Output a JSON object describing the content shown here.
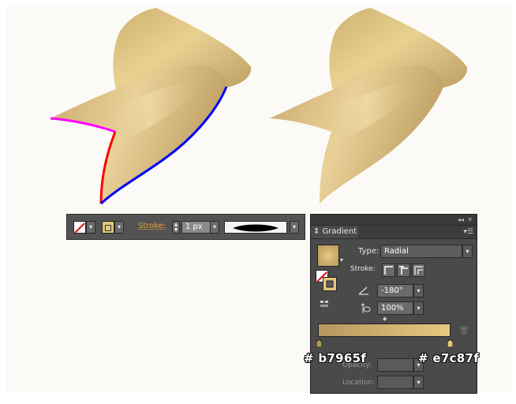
{
  "toolbar": {
    "stroke_label": "Stroke:",
    "stroke_weight": "1 px"
  },
  "gradient_panel": {
    "tab_title": "Gradient",
    "type_label": "Type:",
    "type_value": "Radial",
    "stroke_label": "Stroke:",
    "angle_value": "-180°",
    "aspect_value": "100%",
    "opacity_label": "Opacity:",
    "location_label": "Location:",
    "stops": [
      {
        "color": "#b7965f",
        "location": 0
      },
      {
        "color": "#e7c87f",
        "location": 100
      }
    ]
  },
  "annotations": {
    "left_stop_hex": "# b7965f",
    "right_stop_hex": "# e7c87f"
  },
  "colors": {
    "guide_magenta": "#ff00ff",
    "guide_red": "#ff0000",
    "guide_blue": "#0000ff",
    "panel_bg": "#4a4a4a",
    "stroke_label_color": "#f0a030"
  },
  "icons": [
    "none-swatch-icon",
    "stroke-swatch-icon",
    "angle-icon",
    "aspect-ratio-icon",
    "gradient-annotator-icon",
    "trash-icon",
    "panel-menu-icon"
  ]
}
